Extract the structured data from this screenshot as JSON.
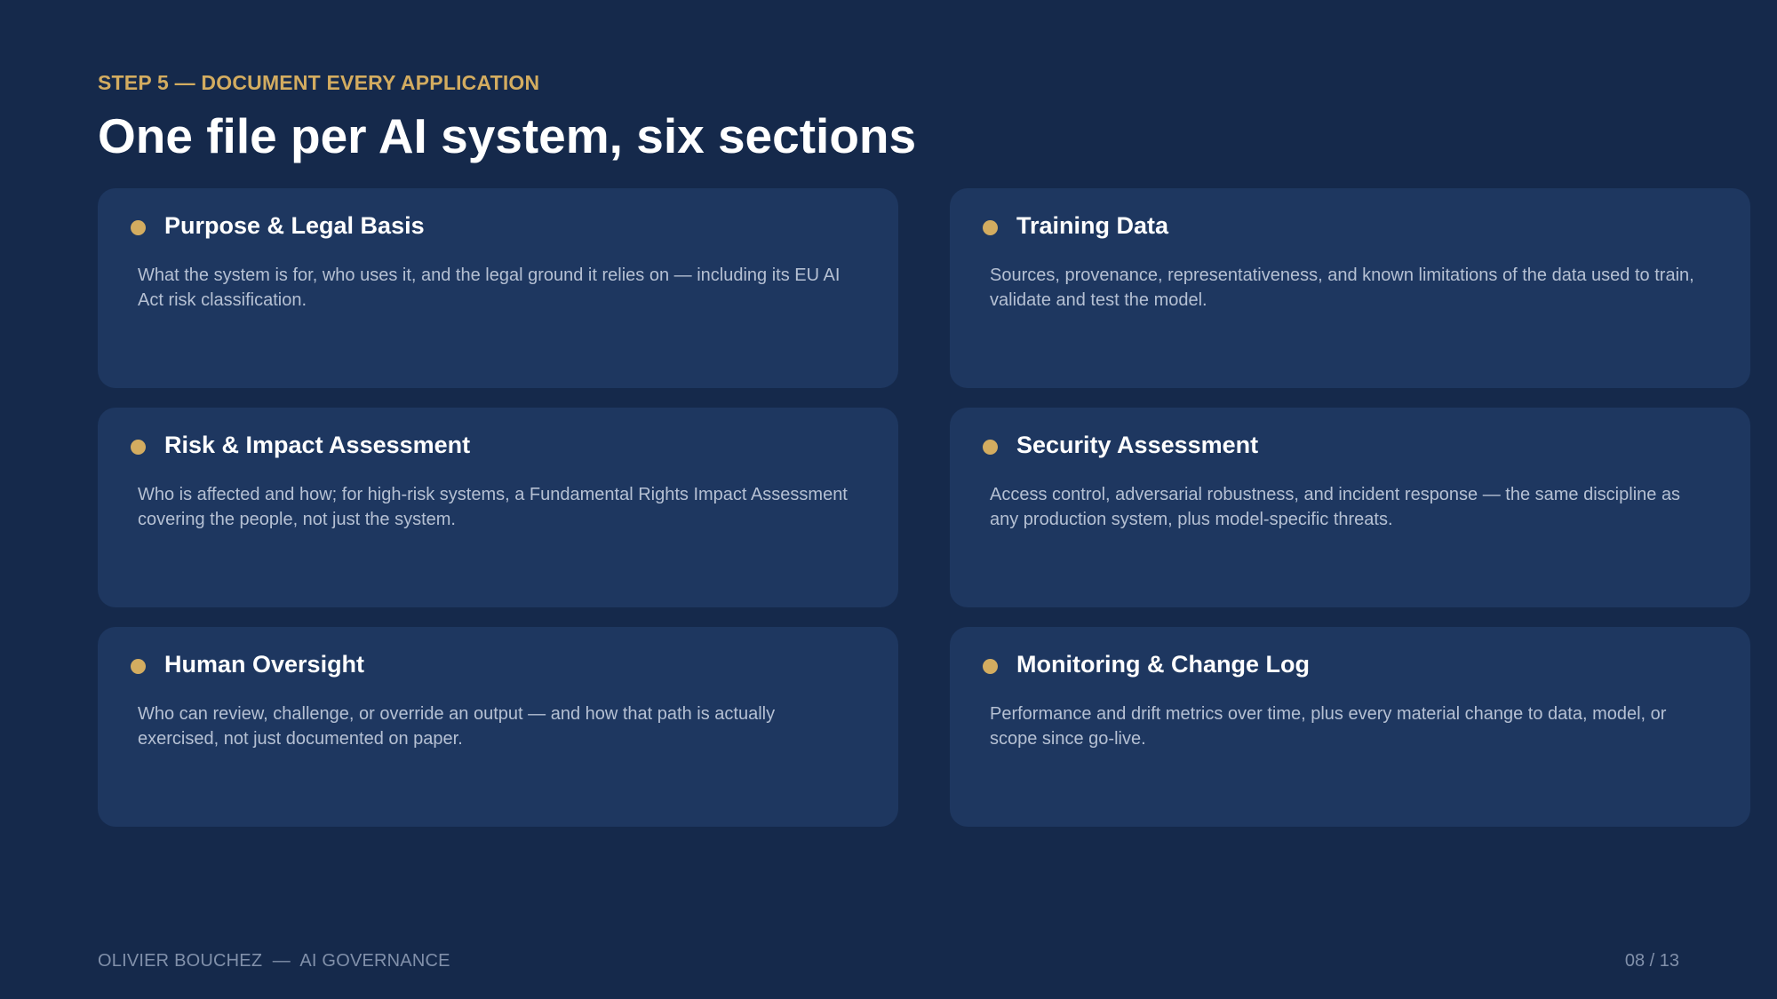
{
  "header": {
    "eyebrow": "STEP 5 — DOCUMENT EVERY APPLICATION",
    "title": "One file per AI system, six sections"
  },
  "cards": [
    {
      "title": "Purpose & Legal Basis",
      "body": "What the system is for, who uses it, and the legal ground it relies on — including its EU AI Act risk classification."
    },
    {
      "title": "Training Data",
      "body": "Sources, provenance, representativeness, and known limitations of the data used to train, validate and test the model."
    },
    {
      "title": "Risk & Impact Assessment",
      "body": "Who is affected and how; for high-risk systems, a Fundamental Rights Impact Assessment covering the people, not just the system."
    },
    {
      "title": "Security Assessment",
      "body": "Access control, adversarial robustness, and incident response — the same discipline as any production system, plus model-specific threats."
    },
    {
      "title": "Human Oversight",
      "body": "Who can review, challenge, or override an output — and how that path is actually exercised, not just documented on paper."
    },
    {
      "title": "Monitoring & Change Log",
      "body": "Performance and drift metrics over time, plus every material change to data, model, or scope since go-live."
    }
  ],
  "footer": {
    "author": "OLIVIER BOUCHEZ  —  AI GOVERNANCE",
    "page": "08 / 13"
  },
  "colors": {
    "background": "#15294b",
    "card": "#1e3760",
    "accent": "#d3ac60"
  }
}
